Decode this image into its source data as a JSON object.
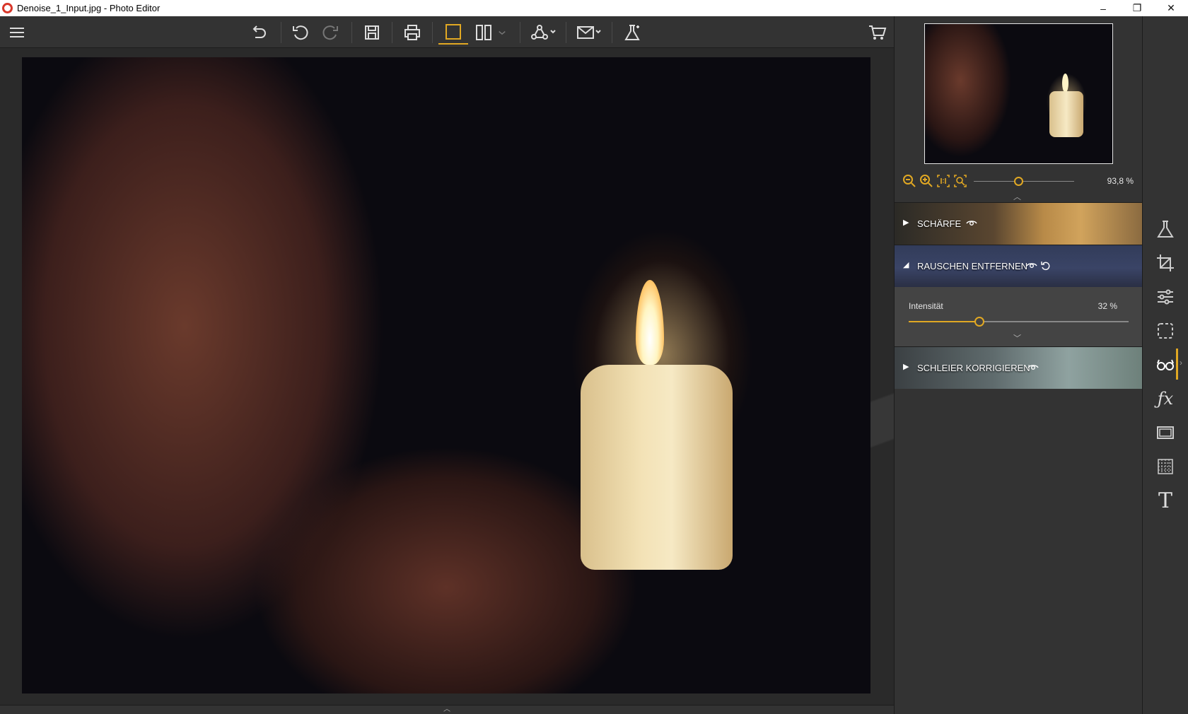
{
  "window": {
    "title": "Denoise_1_Input.jpg - Photo Editor",
    "controls": {
      "minimize": "–",
      "maximize": "❐",
      "close": "✕"
    }
  },
  "toolbar": {
    "items": [
      "menu-icon",
      "undo-all-icon",
      "undo-icon",
      "redo-icon",
      "save-icon",
      "print-icon",
      "single-view-icon",
      "split-view-icon",
      "compare-dropdown-icon",
      "share-icon",
      "export-icon",
      "lab-icon",
      "cart-icon"
    ],
    "accent_color": "#e1a823"
  },
  "navigator": {
    "zoom_value": "93,8 %",
    "zoom_fraction": 0.45,
    "zoom_icons": [
      "zoom-out-icon",
      "zoom-in-icon",
      "actual-size-icon",
      "fit-icon"
    ]
  },
  "sections": {
    "sharpness": {
      "label": "SCHÄRFE",
      "expanded": false
    },
    "noise": {
      "label": "RAUSCHEN ENTFERNEN",
      "expanded": true,
      "intensity_label": "Intensität",
      "intensity_value": "32 %",
      "intensity_fraction": 0.32
    },
    "haze": {
      "label": "SCHLEIER KORRIGIEREN",
      "expanded": false
    }
  },
  "tools": [
    "lab-icon",
    "crop-icon",
    "adjust-sliders-icon",
    "selection-icon",
    "glasses-icon",
    "fx-icon",
    "frame-icon",
    "texture-icon",
    "text-icon"
  ],
  "tool_labels": {
    "fx": "ƒx",
    "text": "T"
  },
  "glyphs": {
    "arrow_right": "▶",
    "arrow_down": "◢",
    "chevron_up": "︿",
    "chevron_down": "﹀",
    "expander": "›"
  }
}
